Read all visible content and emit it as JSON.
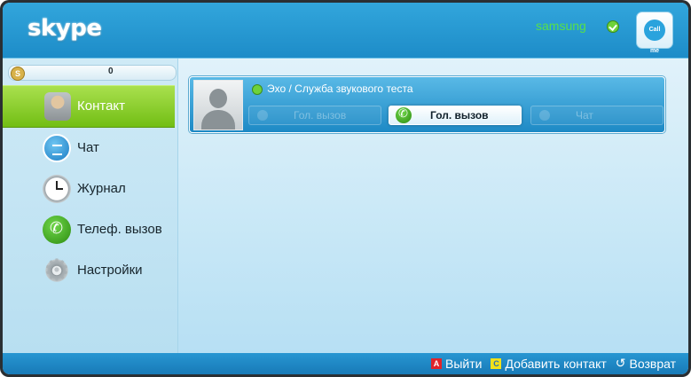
{
  "header": {
    "logo_text": "skype",
    "username": "samsung",
    "status_icon": "online-check-icon",
    "callme_badge": "Call me"
  },
  "sidebar": {
    "balance": "0",
    "items": [
      {
        "label": "Контакт",
        "icon": "contact-icon",
        "active": true
      },
      {
        "label": "Чат",
        "icon": "chat-icon",
        "active": false
      },
      {
        "label": "Журнал",
        "icon": "clock-icon",
        "active": false
      },
      {
        "label": "Телеф. вызов",
        "icon": "phone-icon",
        "active": false
      },
      {
        "label": "Настройки",
        "icon": "gear-icon",
        "active": false
      }
    ]
  },
  "contact_card": {
    "name": "Эхо / Служба звукового теста",
    "actions": [
      {
        "label": "Гол. вызов",
        "icon": "video-icon",
        "focused": false
      },
      {
        "label": "Гол. вызов",
        "icon": "phone-icon",
        "focused": true
      },
      {
        "label": "Чат",
        "icon": "chat-icon",
        "focused": false
      }
    ]
  },
  "footer": {
    "key_a": "A",
    "exit_label": "Выйти",
    "key_c": "C",
    "add_contact_label": "Добавить контакт",
    "return_label": "Возврат"
  },
  "colors": {
    "header_blue": "#1d8cc8",
    "active_green": "#72be14",
    "username_green": "#56e04a",
    "key_red": "#e0232a",
    "key_yellow": "#f2e11a"
  }
}
